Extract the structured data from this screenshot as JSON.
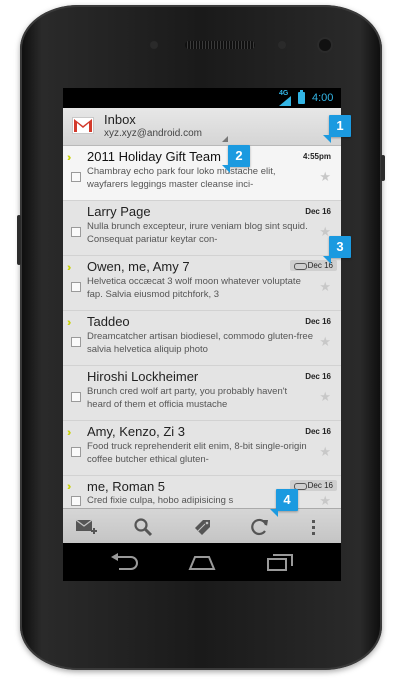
{
  "status": {
    "network": "4G",
    "time": "4:00"
  },
  "header": {
    "title": "Inbox",
    "account": "xyz.xyz@android.com"
  },
  "messages": [
    {
      "sender": "2011 Holiday Gift Team",
      "date": "4:55pm",
      "snippet": "Chambray echo park four loko mustache elit, wayfarers leggings master cleanse inci-",
      "unread": true,
      "important": true,
      "attachment": false
    },
    {
      "sender": "Larry Page",
      "date": "Dec 16",
      "snippet": "Nulla brunch excepteur, irure veniam blog sint squid. Consequat pariatur keytar con-",
      "unread": false,
      "important": false,
      "attachment": false
    },
    {
      "sender": "Owen, me, Amy  7",
      "date": "Dec 16",
      "snippet": "Helvetica occæcat 3 wolf moon whatever voluptate fap. Salvia eiusmod pitchfork, 3",
      "unread": false,
      "important": true,
      "attachment": true
    },
    {
      "sender": "Taddeo",
      "date": "Dec 16",
      "snippet": "Dreamcatcher artisan biodiesel, commodo gluten-free salvia helvetica aliquip photo",
      "unread": false,
      "important": true,
      "attachment": false
    },
    {
      "sender": "Hiroshi Lockheimer",
      "date": "Dec 16",
      "snippet": "Brunch cred wolf art party, you probably haven't heard of them et officia mustache",
      "unread": false,
      "important": false,
      "attachment": false
    },
    {
      "sender": "Amy, Kenzo, Zi  3",
      "date": "Dec 16",
      "snippet": "Food truck reprehenderit elit enim, 8-bit single-origin coffee butcher ethical gluten-",
      "unread": false,
      "important": true,
      "attachment": false
    },
    {
      "sender": "me, Roman  5",
      "date": "Dec 16",
      "snippet": "Cred fixie culpa, hobo adipisicing s",
      "unread": false,
      "important": true,
      "attachment": true
    }
  ],
  "bottombar": [
    "compose-icon",
    "search-icon",
    "labels-icon",
    "refresh-icon",
    "overflow-menu-icon"
  ],
  "navbar": [
    "back-icon",
    "home-icon",
    "recent-apps-icon"
  ],
  "callouts": [
    "1",
    "2",
    "3",
    "4"
  ],
  "colors": {
    "accent": "#33b5e5",
    "callout": "#1b9ae0",
    "important": "#c9d20a"
  }
}
